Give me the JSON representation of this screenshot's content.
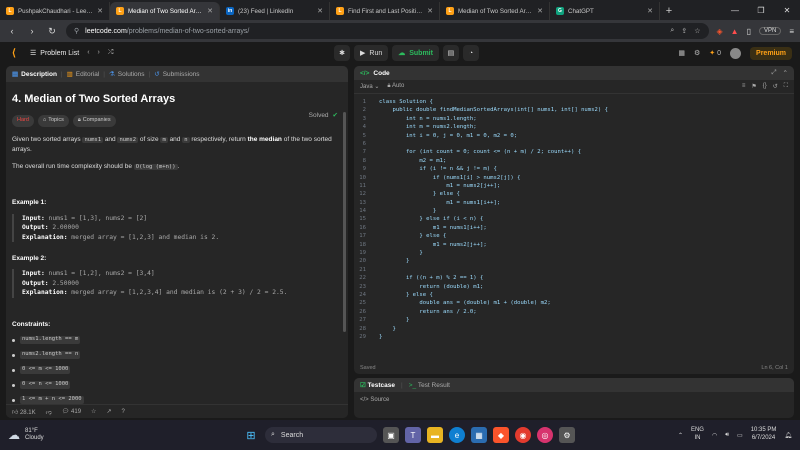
{
  "browser": {
    "tabs": [
      {
        "label": "PushpakChaudhari - LeetCode",
        "color": "#ffa116",
        "glyph": "L"
      },
      {
        "label": "Median of Two Sorted Arrays",
        "color": "#ffa116",
        "glyph": "L",
        "active": true
      },
      {
        "label": "(23) Feed | LinkedIn",
        "color": "#0a66c2",
        "glyph": "in"
      },
      {
        "label": "Find First and Last Position of E",
        "color": "#ffa116",
        "glyph": "L"
      },
      {
        "label": "Median of Two Sorted Arrays",
        "color": "#ffa116",
        "glyph": "L"
      },
      {
        "label": "ChatGPT",
        "color": "#10a37f",
        "glyph": "G"
      }
    ],
    "url_host": "leetcode.com",
    "url_path": "/problems/median-of-two-sorted-arrays/",
    "vpn_label": "VPN"
  },
  "lcnav": {
    "problem_list": "Problem List",
    "run": "Run",
    "submit": "Submit",
    "coins": "0",
    "premium": "Premium"
  },
  "left": {
    "tabs": [
      "Description",
      "Editorial",
      "Solutions",
      "Submissions"
    ],
    "title": "4. Median of Two Sorted Arrays",
    "solved": "Solved",
    "badges": [
      "Hard",
      "Topics",
      "Companies"
    ],
    "desc_1a": "Given two sorted arrays ",
    "desc_1b": "nums1",
    "desc_1c": " and ",
    "desc_1d": "nums2",
    "desc_1e": " of size ",
    "desc_1f": "m",
    "desc_1g": " and ",
    "desc_1h": "n",
    "desc_1i": " respectively, return ",
    "desc_1j": "the median",
    "desc_1k": " of the two sorted arrays.",
    "desc_2a": "The overall run time complexity should be ",
    "desc_2b": "O(log (m+n))",
    "desc_2c": ".",
    "ex1_title": "Example 1:",
    "ex1_input_label": "Input:",
    "ex1_input": " nums1 = [1,3], nums2 = [2]",
    "ex1_output_label": "Output:",
    "ex1_output": " 2.00000",
    "ex1_expl_label": "Explanation:",
    "ex1_expl": " merged array = [1,2,3] and median is 2.",
    "ex2_title": "Example 2:",
    "ex2_input_label": "Input:",
    "ex2_input": " nums1 = [1,2], nums2 = [3,4]",
    "ex2_output_label": "Output:",
    "ex2_output": " 2.50000",
    "ex2_expl_label": "Explanation:",
    "ex2_expl": " merged array = [1,2,3,4] and median is (2 + 3) / 2 = 2.5.",
    "constraints_title": "Constraints:",
    "constraints": [
      "nums1.length == m",
      "nums2.length == n",
      "0 <= m <= 1000",
      "0 <= n <= 1000",
      "1 <= m + n <= 2000"
    ],
    "likes": "28.1K",
    "comments": "419"
  },
  "code": {
    "title": "Code",
    "language": "Java",
    "mode": "Auto",
    "lines": [
      "class Solution {",
      "    public double findMedianSortedArrays(int[] nums1, int[] nums2) {",
      "        int n = nums1.length;",
      "        int m = nums2.length;",
      "        int i = 0, j = 0, m1 = 0, m2 = 0;",
      "",
      "        for (int count = 0; count <= (n + m) / 2; count++) {",
      "            m2 = m1;",
      "            if (i != n && j != m) {",
      "                if (nums1[i] > nums2[j]) {",
      "                    m1 = nums2[j++];",
      "                } else {",
      "                    m1 = nums1[i++];",
      "                }",
      "            } else if (i < n) {",
      "                m1 = nums1[i++];",
      "            } else {",
      "                m1 = nums2[j++];",
      "            }",
      "        }",
      "",
      "        if ((n + m) % 2 == 1) {",
      "            return (double) m1;",
      "        } else {",
      "            double ans = (double) m1 + (double) m2;",
      "            return ans / 2.0;",
      "        }",
      "    }",
      "}"
    ],
    "saved": "Saved",
    "cursor": "Ln 6, Col 1"
  },
  "testpanel": {
    "testcase": "Testcase",
    "result": "Test Result",
    "source": "Source"
  },
  "taskbar": {
    "temp": "81°F",
    "weather": "Cloudy",
    "search": "Search",
    "lang1": "ENG",
    "lang2": "IN",
    "time": "10:35 PM",
    "date": "6/7/2024"
  }
}
